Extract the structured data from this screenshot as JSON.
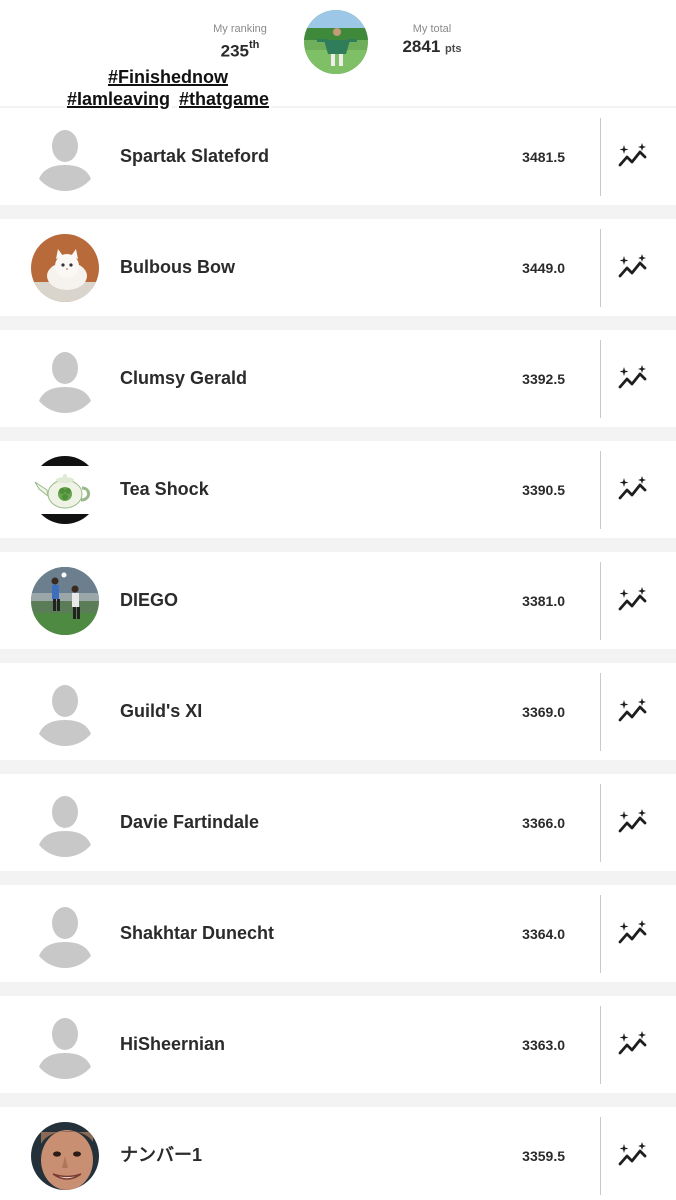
{
  "header": {
    "ranking_label": "My ranking",
    "ranking_value": "235",
    "ranking_suffix": "th",
    "total_label": "My total",
    "total_value": "2841",
    "total_unit": "pts",
    "hashtag_line1": "#Finishednow",
    "hashtag_line2a": "#Iamleaving",
    "hashtag_line2b": "#thatgame"
  },
  "rows": [
    {
      "name": "Spartak Slateford",
      "score": "3481.5",
      "avatar": "default-avatar-icon"
    },
    {
      "name": "Bulbous Bow",
      "score": "3449.0",
      "avatar": "cat-photo-avatar"
    },
    {
      "name": "Clumsy Gerald",
      "score": "3392.5",
      "avatar": "default-avatar-icon"
    },
    {
      "name": "Tea Shock",
      "score": "3390.5",
      "avatar": "teapot-photo-avatar"
    },
    {
      "name": "DIEGO",
      "score": "3381.0",
      "avatar": "football-photo-avatar"
    },
    {
      "name": "Guild's XI",
      "score": "3369.0",
      "avatar": "default-avatar-icon"
    },
    {
      "name": "Davie Fartindale",
      "score": "3366.0",
      "avatar": "default-avatar-icon"
    },
    {
      "name": "Shakhtar Dunecht",
      "score": "3364.0",
      "avatar": "default-avatar-icon"
    },
    {
      "name": "HiSheernian",
      "score": "3363.0",
      "avatar": "default-avatar-icon"
    },
    {
      "name": "ナンバー1",
      "score": "3359.5",
      "avatar": "face-photo-avatar"
    }
  ],
  "icons": {
    "row_action": "chart-sparkle-icon"
  }
}
